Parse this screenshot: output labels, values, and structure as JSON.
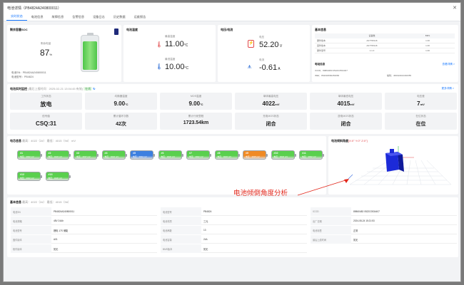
{
  "window": {
    "title": "电池详情（PB4824A240800011）"
  },
  "tabs": [
    "实时状态",
    "电池信息",
    "故障信息",
    "告警信息",
    "设备日志",
    "历史数据",
    "运维报告"
  ],
  "soc": {
    "title": "剩余容量SOC",
    "label": "剩余电量",
    "value": "87",
    "unit": "%",
    "serial_label": "电池SN：",
    "serial": "PB4824A240800011",
    "model_label": "电池型号：",
    "model": "PB4824"
  },
  "temp": {
    "title": "电池温度",
    "max_label": "最高温度",
    "max": "11.00",
    "min_label": "最低温度",
    "min": "10.00",
    "unit": "°C"
  },
  "voltage": {
    "title": "电压/电流",
    "v_label": "电压",
    "v": "52.20",
    "v_unit": " V",
    "i_label": "电流",
    "i": "-0.61",
    "i_unit": " A"
  },
  "basic": {
    "title": "基本信息",
    "headers": [
      "",
      "设备数",
      "BMS"
    ],
    "rows": [
      [
        "硬件版本",
        "A07795116",
        "1.00"
      ],
      [
        "固件版本",
        "A07795116",
        "1.00"
      ],
      [
        "硬件型号",
        "1.1.0",
        "1.00"
      ]
    ]
  },
  "station": {
    "title": "电站信息",
    "iccid_label": "ICCID：",
    "iccid": "89860483 0522C0534407",
    "imei_label": "IMEI：",
    "imei": "864018060263066",
    "code_label": "编码：",
    "code": "460024021340355",
    "more": "查看详情 >"
  },
  "monitor": {
    "title": "电池实时监控",
    "sub": "(最后上报时间：2025-02-21 13:04:45 有效) ",
    "badge": "在线",
    "more": "更多详情 >",
    "cells": [
      {
        "label": "工作状态",
        "value": "放电",
        "unit": ""
      },
      {
        "label": "均衡器温度",
        "value": "9.00",
        "unit": "°C"
      },
      {
        "label": "MOS温度",
        "value": "9.00",
        "unit": "°C"
      },
      {
        "label": "单体最高电压",
        "value": "4022",
        "unit": "mV"
      },
      {
        "label": "单体最低电压",
        "value": "4015",
        "unit": "mV"
      },
      {
        "label": "电压差",
        "value": "7",
        "unit": "mV"
      },
      {
        "label": "信号值",
        "value": "CSQ:31",
        "unit": ""
      },
      {
        "label": "累计循环次数",
        "value": "42次",
        "unit": ""
      },
      {
        "label": "累计行驶里程",
        "value": "1723.54km",
        "unit": ""
      },
      {
        "label": "充电MOS状态",
        "value": "闭合",
        "unit": ""
      },
      {
        "label": "放电MOS状态",
        "value": "闭合",
        "unit": ""
      },
      {
        "label": "在位状态",
        "value": "在位",
        "unit": ""
      }
    ]
  },
  "cells_card": {
    "title": "电芯信息",
    "sub": "最高：4022（2#）  最低：4015（9#）  mV",
    "items": [
      {
        "n": "#1",
        "v": "电压：4022 mV",
        "c": "#5ad04e"
      },
      {
        "n": "#2",
        "v": "电压：4022 mV",
        "c": "#5ad04e"
      },
      {
        "n": "#3",
        "v": "电压：4017 mV",
        "c": "#5ad04e"
      },
      {
        "n": "#4",
        "v": "电压：4022 mV",
        "c": "#5ad04e"
      },
      {
        "n": "#5",
        "v": "电压：4022 mV",
        "c": "#3d7fe0"
      },
      {
        "n": "#6",
        "v": "电压：4022 mV",
        "c": "#5ad04e"
      },
      {
        "n": "#7",
        "v": "电压：4022 mV",
        "c": "#5ad04e"
      },
      {
        "n": "#8",
        "v": "电压：4022 mV",
        "c": "#5ad04e"
      },
      {
        "n": "#9",
        "v": "电压：4015 mV",
        "c": "#f08a24"
      },
      {
        "n": "#10",
        "v": "电压：4022 mV",
        "c": "#5ad04e"
      },
      {
        "n": "#11",
        "v": "电压：4022 mV",
        "c": "#5ad04e"
      },
      {
        "n": "#12",
        "v": "电压：4022 mV",
        "c": "#5ad04e"
      },
      {
        "n": "#13",
        "v": "电压：4020 mV",
        "c": "#5ad04e"
      }
    ]
  },
  "tilt": {
    "title": "电池倾斜角度",
    "sub": "[X:0° Y:0° Z:0°]"
  },
  "annotation": "电池倾倒角度分析",
  "info": {
    "title": "基本信息",
    "sub": "最高：4022（2#）  最低：4015（9#）",
    "rows": [
      [
        [
          "电池SN",
          "PB4824A240800011"
        ],
        [
          "电池型号",
          "PB4824"
        ],
        [
          "ICCID",
          "89860483 0522C0534407"
        ]
      ],
      [
        [
          "电池规格",
          "48V 24Ah"
        ],
        [
          "电池材质",
          "三元"
        ],
        [
          "出厂日期",
          "2024-08-24 15:21:53"
        ]
      ],
      [
        [
          "电池型号",
          "锂电 17S 储能"
        ],
        [
          "电池串数",
          "13"
        ],
        [
          "电池标签",
          "正常"
        ]
      ],
      [
        [
          "固件版本",
          "A01"
        ],
        [
          "电池容量",
          "24A"
        ],
        [
          "最后上线时间",
          "暂无"
        ]
      ],
      [
        [
          "软件版本",
          "暂无"
        ],
        [
          "BMS版本",
          "暂无"
        ]
      ]
    ]
  }
}
